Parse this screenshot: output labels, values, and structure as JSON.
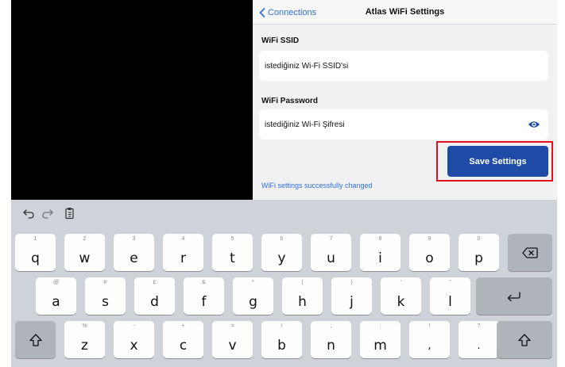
{
  "nav": {
    "back_label": "Connections",
    "title": "Atlas WiFi Settings"
  },
  "ssid": {
    "label": "WiFi SSID",
    "value": "istediğiniz Wi-Fi SSID'si"
  },
  "password": {
    "label": "WiFi Password",
    "value": "istediğiniz Wi-Fi Şifresi"
  },
  "save_button": "Save Settings",
  "status_message": "WiFi settings successfully changed",
  "colors": {
    "accent": "#2f6fe0",
    "save_button": "#1e4ba6",
    "highlight": "#e3101b"
  },
  "keyboard": {
    "row1": [
      {
        "hint": "1",
        "key": "q"
      },
      {
        "hint": "2",
        "key": "w"
      },
      {
        "hint": "3",
        "key": "e"
      },
      {
        "hint": "4",
        "key": "r"
      },
      {
        "hint": "5",
        "key": "t"
      },
      {
        "hint": "6",
        "key": "y"
      },
      {
        "hint": "7",
        "key": "u"
      },
      {
        "hint": "8",
        "key": "i"
      },
      {
        "hint": "9",
        "key": "o"
      },
      {
        "hint": "0",
        "key": "p"
      }
    ],
    "row2": [
      {
        "hint": "@",
        "key": "a"
      },
      {
        "hint": "#",
        "key": "s"
      },
      {
        "hint": "£",
        "key": "d"
      },
      {
        "hint": "&",
        "key": "f"
      },
      {
        "hint": "*",
        "key": "g"
      },
      {
        "hint": "(",
        "key": "h"
      },
      {
        "hint": ")",
        "key": "j"
      },
      {
        "hint": "'",
        "key": "k"
      },
      {
        "hint": "\"",
        "key": "l"
      }
    ],
    "row3": [
      {
        "hint": "%",
        "key": "z"
      },
      {
        "hint": "-",
        "key": "x"
      },
      {
        "hint": "+",
        "key": "c"
      },
      {
        "hint": "=",
        "key": "v"
      },
      {
        "hint": "/",
        "key": "b"
      },
      {
        "hint": ";",
        "key": "n"
      },
      {
        "hint": ":",
        "key": "m"
      },
      {
        "hint": "!",
        "key": ","
      },
      {
        "hint": "?",
        "key": "."
      }
    ],
    "icons": [
      "undo-icon",
      "redo-icon",
      "paste-icon",
      "backspace-icon",
      "return-icon",
      "shift-icon"
    ]
  }
}
